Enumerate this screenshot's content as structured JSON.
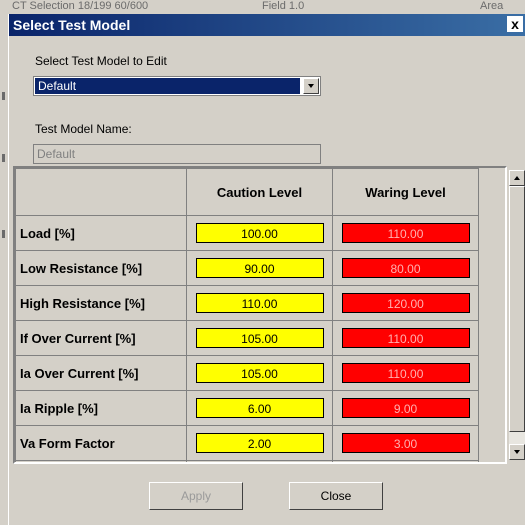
{
  "background": {
    "strip_texts": [
      "CT Selection  18/199  60/600",
      "Field  1.0",
      "Area"
    ]
  },
  "dialog": {
    "title": "Select Test Model",
    "close_glyph": "x",
    "select_label": "Select Test Model to Edit",
    "select_value": "Default",
    "name_label": "Test Model Name:",
    "name_value": "Default"
  },
  "grid": {
    "columns": [
      "",
      "Caution Level",
      "Waring Level"
    ],
    "rows": [
      {
        "label": "Load [%]",
        "caution": "100.00",
        "warning": "110.00"
      },
      {
        "label": "Low Resistance [%]",
        "caution": "90.00",
        "warning": "80.00"
      },
      {
        "label": "High Resistance [%]",
        "caution": "110.00",
        "warning": "120.00"
      },
      {
        "label": "If Over Current [%]",
        "caution": "105.00",
        "warning": "110.00"
      },
      {
        "label": "Ia Over Current [%]",
        "caution": "105.00",
        "warning": "110.00"
      },
      {
        "label": "Ia Ripple [%]",
        "caution": "6.00",
        "warning": "9.00"
      },
      {
        "label": "Va Form Factor",
        "caution": "2.00",
        "warning": "3.00"
      }
    ]
  },
  "buttons": {
    "apply": "Apply",
    "close": "Close"
  },
  "colors": {
    "caution": "#ffff00",
    "warning": "#ff0000",
    "titlebar": "#0a246a"
  },
  "icons": {
    "combo_arrow": "chevron-down-icon",
    "scroll_up": "scroll-up-icon",
    "scroll_down": "scroll-down-icon"
  }
}
